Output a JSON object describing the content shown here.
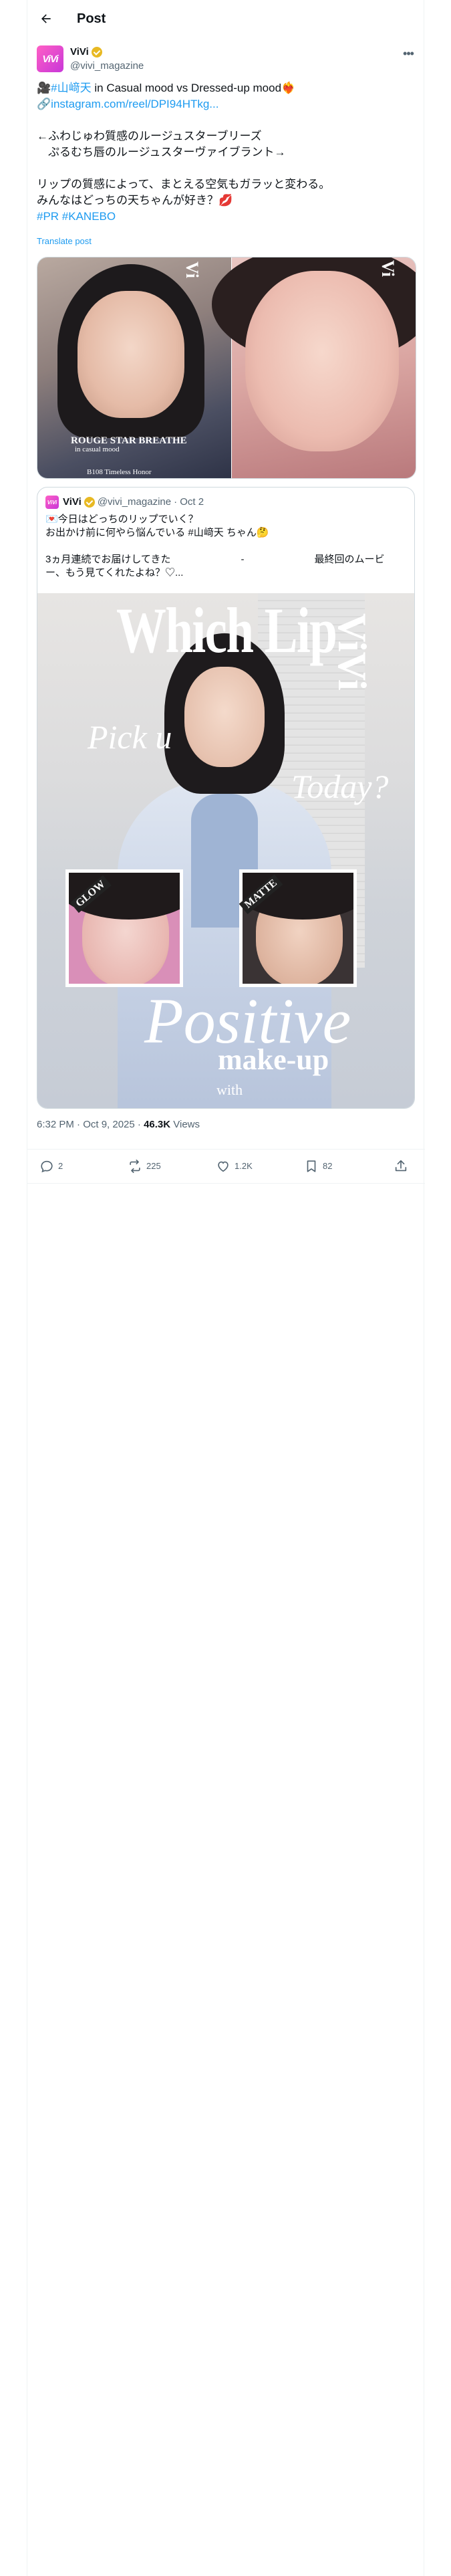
{
  "header": {
    "title": "Post"
  },
  "author": {
    "name": "ViVi",
    "handle": "@vivi_magazine",
    "avatar_text": "ViVi"
  },
  "post": {
    "line1_prefix": "🎥",
    "line1_hashtag": "#山﨑天",
    "line1_rest": " in Casual mood vs Dressed-up mood❤️‍🔥",
    "link_prefix": "🔗",
    "link": "instagram.com/reel/DPI94HTkg...",
    "para2": "←ふわじゅわ質感のルージュスターブリーズ\n　ぷるむち唇のルージュスターヴァイブラント→",
    "para3": "リップの質感によって、まとえる空気もガラッと変わる。\nみんなはどっちの天ちゃんが好き？💋",
    "hashtags": "#PR #KANEBO",
    "translate": "Translate post"
  },
  "media": {
    "img1_title": "ROUGE STAR BREATHE",
    "img1_sub": "in casual mood",
    "img1_shade": "B108 Timeless Honor"
  },
  "quote": {
    "name": "ViVi",
    "handle": "@vivi_magazine",
    "date": "· Oct 2",
    "text": "💌今日はどっちのリップでいく？\nお出かけ前に何やら悩んでいる #山﨑天 ちゃん🤔\n\n3ヵ月連続でお届けしてきた　　　　　　　-　　　　　　　最終回のムービ\nー、もう見てくれたよね？♡...",
    "img_title": "Which Lip",
    "img_side": "ViVi",
    "pick": "Pick u",
    "today": "Today?",
    "glow": "GLOW",
    "matte": "MATTE",
    "positive": "Positive",
    "makeup": "make-up",
    "with": "with"
  },
  "meta": {
    "time": "6:32 PM · Oct 9, 2025 · ",
    "views_count": "46.3K",
    "views_label": " Views"
  },
  "actions": {
    "replies": "2",
    "reposts": "225",
    "likes": "1.2K",
    "bookmarks": "82"
  }
}
